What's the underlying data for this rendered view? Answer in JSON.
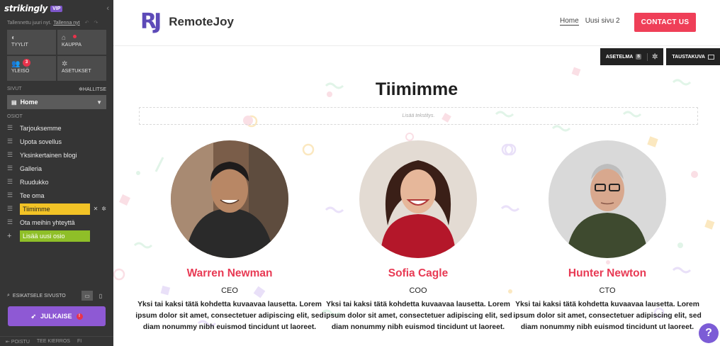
{
  "sidebar": {
    "logo": "strikingly",
    "vip": "VIP",
    "saved_text": "Tallennettu juuri nyt.",
    "saved_link": "Tallenna nyt",
    "tiles": [
      {
        "label": "TYYLIT",
        "icon": "palette-icon"
      },
      {
        "label": "KAUPPA",
        "icon": "shop-bag-icon"
      },
      {
        "label": "YLEISÖ",
        "icon": "audience-icon",
        "badge": "3"
      },
      {
        "label": "ASETUKSET",
        "icon": "settings-icon"
      }
    ],
    "pages_label": "SIVUT",
    "manage_label": "HALLITSE",
    "current_page": "Home",
    "sections_label": "OSIOT",
    "sections": [
      "Tarjouksemme",
      "Upota sovellus",
      "Yksinkertainen blogi",
      "Galleria",
      "Ruudukko",
      "Tee oma",
      "Tiimimme",
      "Ota meihin yhteyttä"
    ],
    "add_section": "Lisää uusi osio",
    "preview_label": "ESIKATSELE SIVUSTO",
    "publish_label": "JULKAISE",
    "footer": [
      "POISTU",
      "TEE KIERROS",
      "FI"
    ]
  },
  "site": {
    "logo_mark": "RJ",
    "brand": "RemoteJoy",
    "nav": [
      "Home",
      "Uusi sivu 2"
    ],
    "cta": "CONTACT US",
    "edit_layout": "ASETELMA",
    "edit_layout_badge": "B",
    "edit_background": "TAUSTAKUVA",
    "section_title": "Tiimimme",
    "subtitle_placeholder": "Lisää tekstitys.",
    "members": [
      {
        "name": "Warren Newman",
        "role": "CEO",
        "bio": "Yksi tai kaksi tätä kohdetta kuvaavaa lausetta. Lorem ipsum dolor sit amet, consectetuer adipiscing elit, sed diam nonummy nibh euismod tincidunt ut laoreet."
      },
      {
        "name": "Sofia Cagle",
        "role": "COO",
        "bio": "Yksi tai kaksi tätä kohdetta kuvaavaa lausetta. Lorem ipsum dolor sit amet, consectetuer adipiscing elit, sed diam nonummy nibh euismod tincidunt ut laoreet."
      },
      {
        "name": "Hunter Newton",
        "role": "CTO",
        "bio": "Yksi tai kaksi tätä kohdetta kuvaavaa lausetta. Lorem ipsum dolor sit amet, consectetuer adipiscing elit, sed diam nonummy nibh euismod tincidunt ut laoreet."
      }
    ],
    "help": "?"
  },
  "colors": {
    "sidebar_bg": "#353535",
    "accent_purple": "#8e59d4",
    "brand_purple": "#5d4ab8",
    "cta_red": "#ef3f58",
    "name_red": "#e83a54",
    "active_section": "#f2c326",
    "add_section": "#8fbf28"
  }
}
